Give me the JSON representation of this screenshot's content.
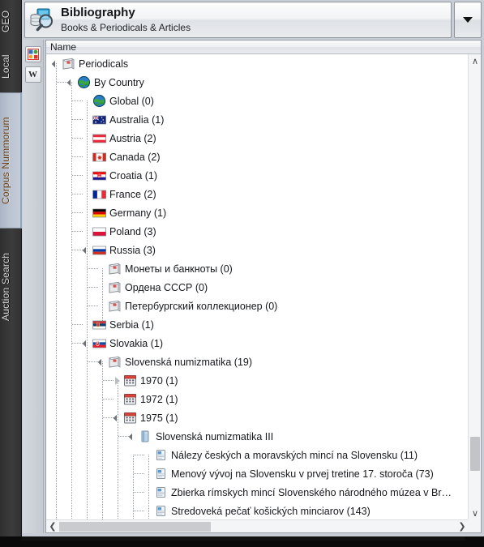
{
  "window": {
    "title": "Bibliography",
    "subtitle": "Books & Periodicals & Articles",
    "app_icon": "database-search-icon",
    "dropdown_icon": "chevron-down-icon"
  },
  "sidebar": {
    "tabs": [
      {
        "label": "GEO",
        "active": false
      },
      {
        "label": "Local",
        "active": false
      },
      {
        "label": "Corpus Nummorum",
        "active": true
      },
      {
        "label": "Auction Search",
        "active": false
      }
    ]
  },
  "toolbar": {
    "buttons": [
      {
        "name": "chart-icon",
        "label": ""
      },
      {
        "name": "wikipedia-icon",
        "label": "W"
      }
    ]
  },
  "tree": {
    "column_header": "Name",
    "rows": [
      {
        "depth": 0,
        "expander": "open",
        "icon": "folder-periodical-icon",
        "label": "Periodicals"
      },
      {
        "depth": 1,
        "expander": "open",
        "icon": "globe-icon",
        "label": "By Country"
      },
      {
        "depth": 2,
        "expander": "none",
        "icon": "globe-icon",
        "label": "Global (0)"
      },
      {
        "depth": 2,
        "expander": "none",
        "icon": "flag-australia-icon",
        "label": "Australia (1)"
      },
      {
        "depth": 2,
        "expander": "none",
        "icon": "flag-austria-icon",
        "label": "Austria (2)"
      },
      {
        "depth": 2,
        "expander": "none",
        "icon": "flag-canada-icon",
        "label": "Canada (2)"
      },
      {
        "depth": 2,
        "expander": "none",
        "icon": "flag-croatia-icon",
        "label": "Croatia (1)"
      },
      {
        "depth": 2,
        "expander": "none",
        "icon": "flag-france-icon",
        "label": "France (2)"
      },
      {
        "depth": 2,
        "expander": "none",
        "icon": "flag-germany-icon",
        "label": "Germany (1)"
      },
      {
        "depth": 2,
        "expander": "none",
        "icon": "flag-poland-icon",
        "label": "Poland (3)"
      },
      {
        "depth": 2,
        "expander": "open",
        "icon": "flag-russia-icon",
        "label": "Russia (3)"
      },
      {
        "depth": 3,
        "expander": "none",
        "icon": "folder-periodical-icon",
        "label": "Монеты и банкноты (0)"
      },
      {
        "depth": 3,
        "expander": "none",
        "icon": "folder-periodical-icon",
        "label": "Ордена СССР (0)"
      },
      {
        "depth": 3,
        "expander": "none",
        "icon": "folder-periodical-icon",
        "label": "Петербургский коллекционер (0)"
      },
      {
        "depth": 2,
        "expander": "none",
        "icon": "flag-serbia-icon",
        "label": "Serbia (1)"
      },
      {
        "depth": 2,
        "expander": "open",
        "icon": "flag-slovakia-icon",
        "label": "Slovakia (1)"
      },
      {
        "depth": 3,
        "expander": "open",
        "icon": "folder-periodical-icon",
        "label": "Slovenská numizmatika (19)"
      },
      {
        "depth": 4,
        "expander": "closed",
        "icon": "calendar-icon",
        "label": "1970 (1)"
      },
      {
        "depth": 4,
        "expander": "none",
        "icon": "calendar-icon",
        "label": "1972 (1)"
      },
      {
        "depth": 4,
        "expander": "open",
        "icon": "calendar-icon",
        "label": "1975 (1)"
      },
      {
        "depth": 5,
        "expander": "open",
        "icon": "book-icon",
        "label": "Slovenská numizmatika III"
      },
      {
        "depth": 6,
        "expander": "none",
        "icon": "article-icon",
        "label": "Nálezy českých a moravských mincí na Slovensku (11)"
      },
      {
        "depth": 6,
        "expander": "none",
        "icon": "article-icon",
        "label": "Menový vývoj na Slovensku v prvej tretine 17. storoča (73)"
      },
      {
        "depth": 6,
        "expander": "none",
        "icon": "article-icon",
        "label": "Zbierka rímskych mincí Slovenského národného múzea v Br…"
      },
      {
        "depth": 6,
        "expander": "none",
        "icon": "article-icon",
        "label": "Stredoveká pečať košických minciarov (143)"
      }
    ]
  },
  "scrollbars": {
    "vertical": {
      "up_icon": "chevron-up-icon",
      "down_icon": "chevron-down-icon"
    },
    "horizontal": {
      "left_icon": "chevron-left-icon",
      "right_icon": "chevron-right-icon"
    }
  },
  "colors": {
    "sidebar_bg": "#3a3a3a",
    "active_tab_text": "#6b3d10",
    "panel_bg": "#c9ced6",
    "tree_bg": "#ffffff",
    "text": "#16181c"
  }
}
